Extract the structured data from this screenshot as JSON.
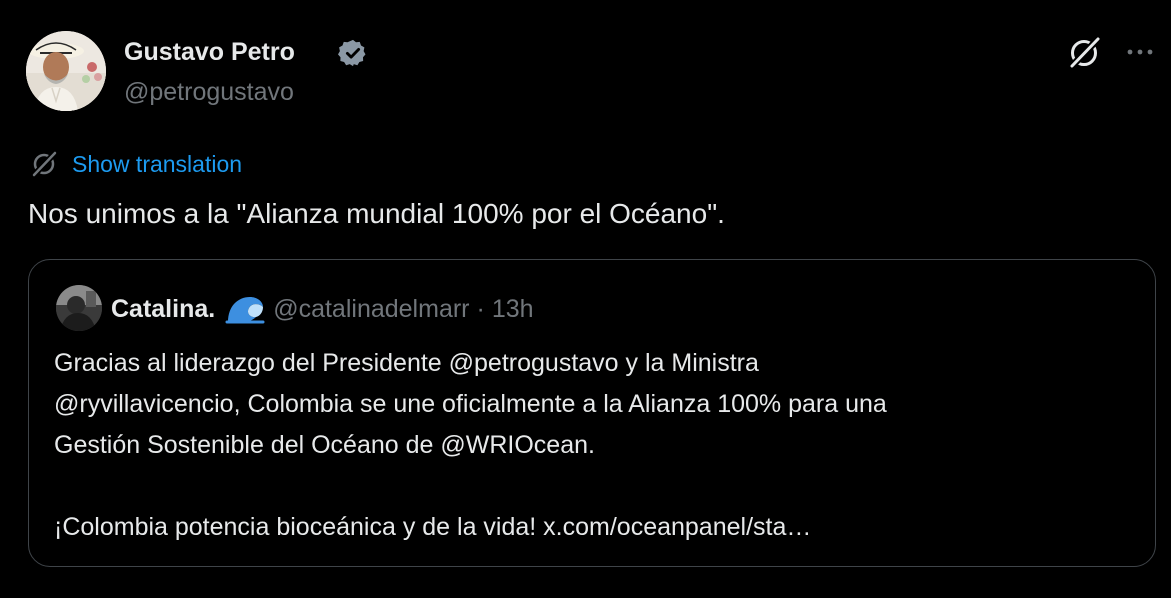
{
  "tweet": {
    "author": {
      "display_name": "Gustavo Petro",
      "handle": "@petrogustavo",
      "verified": true
    },
    "show_translation_label": "Show translation",
    "text": "Nos unimos a la \"Alianza mundial 100% por el Océano\".",
    "actions": {
      "grok_icon": "grok-slash-icon",
      "more_icon": "more-dots-icon"
    }
  },
  "quote": {
    "author": {
      "display_name": "Catalina.",
      "emoji": "wave-emoji",
      "handle": "@catalinadelmarr",
      "separator": "·",
      "time": "13h"
    },
    "lines": [
      "Gracias al liderazgo del Presidente @petrogustavo y la Ministra",
      "@ryvillavicencio, Colombia se une oficialmente a la Alianza 100% para una",
      "Gestión Sostenible del Océano de @WRIOcean."
    ],
    "closing": "¡Colombia potencia bioceánica y de la vida! x.com/oceanpanel/sta…"
  },
  "colors": {
    "background": "#000000",
    "primary_text": "#e7e9ea",
    "secondary_text": "#71767b",
    "link": "#1d9bf0",
    "border": "#3f4449"
  }
}
